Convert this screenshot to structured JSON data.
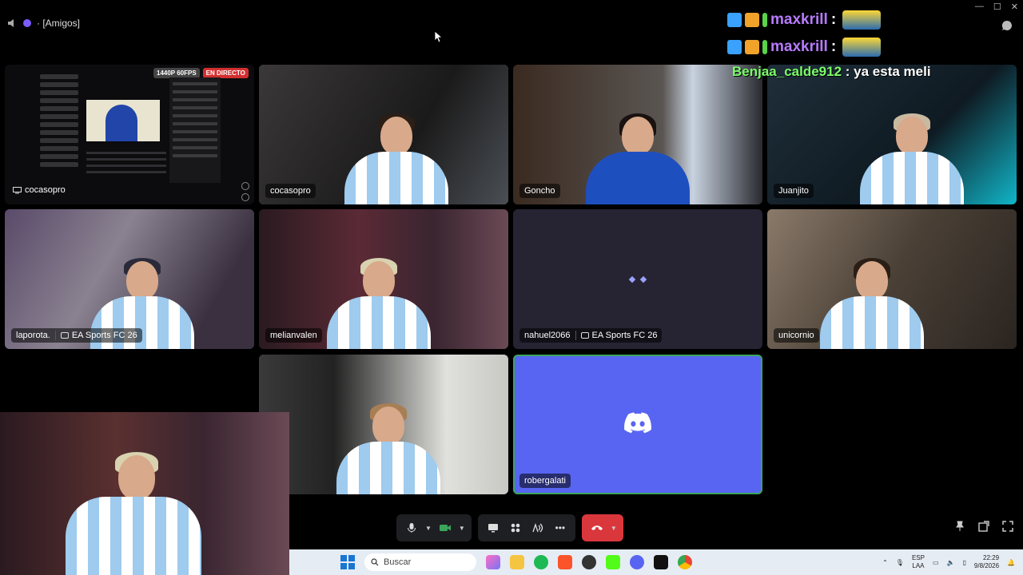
{
  "header": {
    "channel": "· [Amigos]"
  },
  "overlay": {
    "line1_user": "maxkrill",
    "line2_user": "maxkrill",
    "line3_user": "Benjaa_calde912",
    "line3_msg": " : ya esta meli",
    "sep": ":"
  },
  "share": {
    "quality": "1440P 60FPS",
    "live": "EN DIRECTO",
    "streamer": "cocasopro"
  },
  "tiles": {
    "t1": "cocasopro",
    "t2": "Goncho",
    "t3": "Juanjito",
    "t4": "laporota.",
    "t4_activity": "EA Sports FC 26",
    "t5": "melianvalen",
    "t6": "nahuel2066",
    "t6_activity": "EA Sports FC 26",
    "t7": "unicornio",
    "t9": "robergalati"
  },
  "taskbar": {
    "search_placeholder": "Buscar",
    "lang1": "ESP",
    "lang2": "LAA",
    "time": "22:29",
    "date": "9/8/2026"
  },
  "colors": {
    "speaking": "#3ba55c",
    "discord": "#5865f2",
    "hangup": "#da373c"
  }
}
